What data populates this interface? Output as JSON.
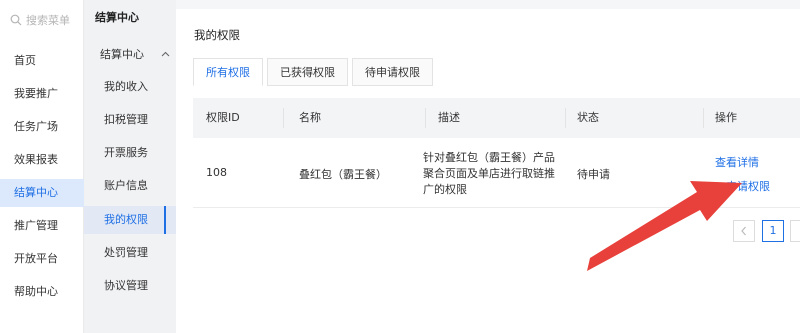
{
  "search": {
    "placeholder": "搜索菜单",
    "icon": "search-icon"
  },
  "nav": {
    "items": [
      {
        "label": "首页"
      },
      {
        "label": "我要推广"
      },
      {
        "label": "任务广场"
      },
      {
        "label": "效果报表"
      },
      {
        "label": "结算中心",
        "active": true
      },
      {
        "label": "推广管理"
      },
      {
        "label": "开放平台"
      },
      {
        "label": "帮助中心"
      }
    ]
  },
  "subnav": {
    "title": "结算中心",
    "group_label": "结算中心",
    "group_icon": "chevron-up-icon",
    "items": [
      {
        "label": "我的收入"
      },
      {
        "label": "扣税管理"
      },
      {
        "label": "开票服务"
      },
      {
        "label": "账户信息"
      },
      {
        "label": "我的权限",
        "active": true
      },
      {
        "label": "处罚管理"
      },
      {
        "label": "协议管理"
      }
    ]
  },
  "main": {
    "title": "我的权限",
    "tabs": [
      {
        "label": "所有权限",
        "active": true
      },
      {
        "label": "已获得权限"
      },
      {
        "label": "待申请权限"
      }
    ],
    "table": {
      "headers": [
        "权限ID",
        "名称",
        "描述",
        "状态",
        "操作"
      ],
      "rows": [
        {
          "id": "108",
          "name": "叠红包（霸王餐）",
          "desc": "针对叠红包（霸王餐）产品聚合页面及单店进行取链推广的权限",
          "status": "待申请",
          "action_view": "查看详情",
          "action_apply": "申请权限"
        }
      ]
    },
    "pagination": {
      "current": "1",
      "prev_icon": "chevron-left-icon"
    }
  },
  "colors": {
    "accent": "#1f6fe5",
    "arrow": "#e8403a",
    "active_nav_bg": "#dce8fb"
  }
}
